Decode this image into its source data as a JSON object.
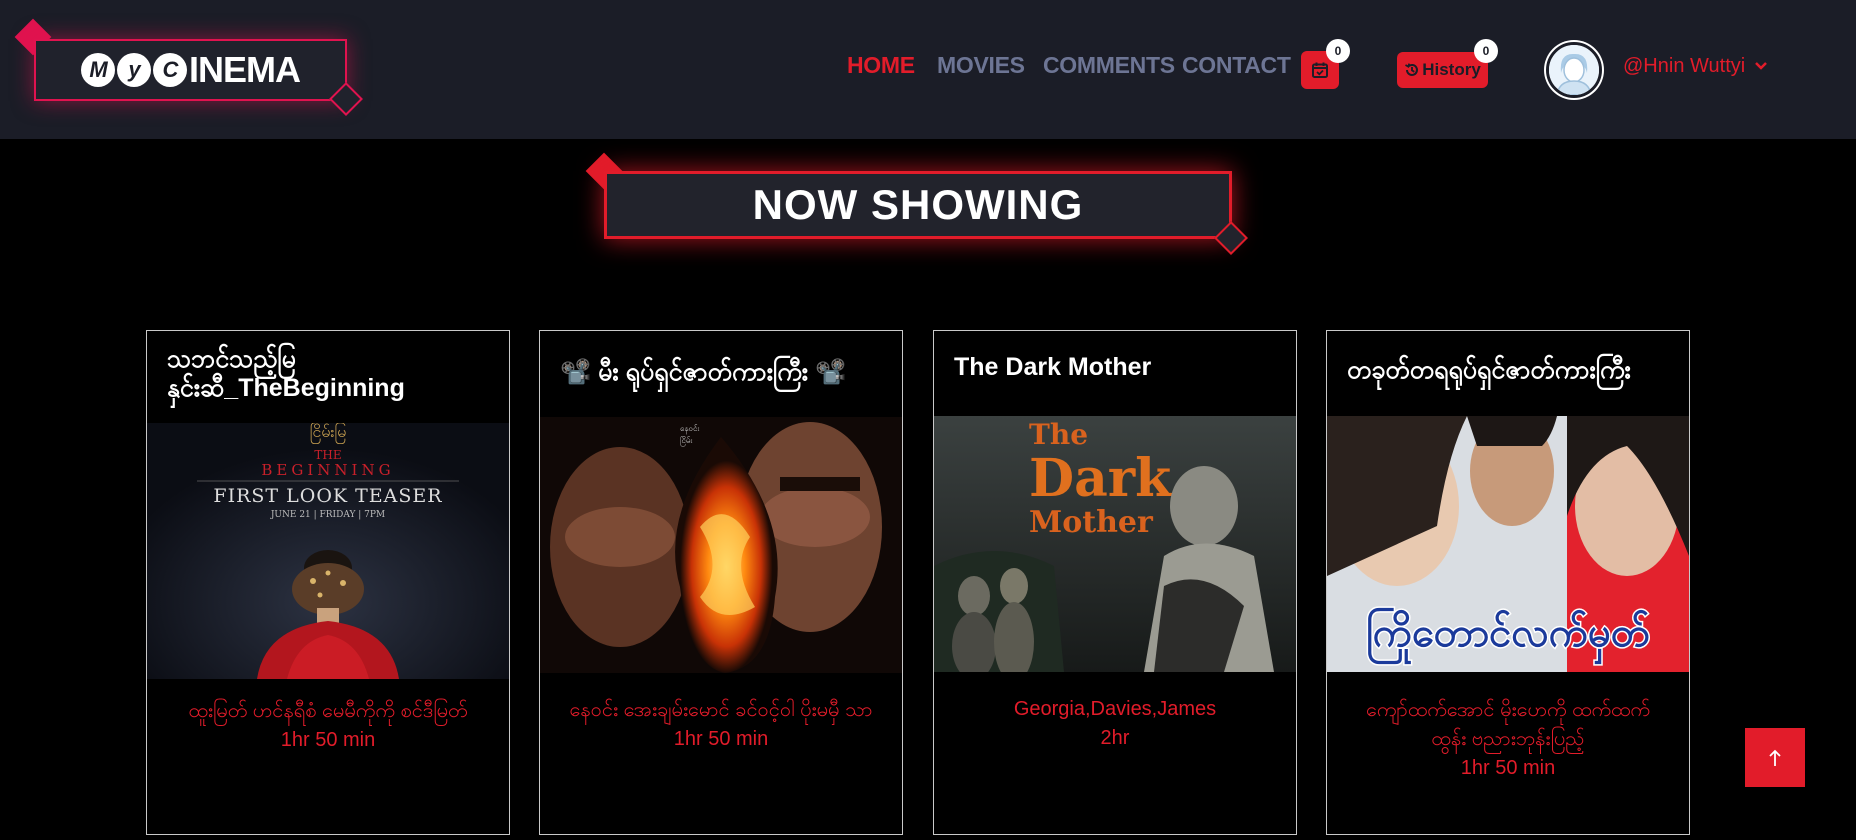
{
  "brand": {
    "logo_text": "MyCINEMA",
    "logo_letters": [
      "M",
      "y",
      "C"
    ],
    "logo_suffix": "INEMA"
  },
  "nav": {
    "items": [
      {
        "label": "HOME",
        "active": true
      },
      {
        "label": "MOVIES",
        "active": false
      },
      {
        "label": "COMMENTS",
        "active": false
      },
      {
        "label": "CONTACT",
        "active": false
      }
    ]
  },
  "header": {
    "cart_count": "0",
    "history_label": "History",
    "history_count": "0",
    "username": "@Hnin Wuttyi"
  },
  "section": {
    "title": "NOW SHOWING"
  },
  "movies": [
    {
      "title": "သဘင်သည့်မြ နှင်းဆီ_TheBeginning",
      "cast": "ထူးမြတ် ဟင်နရီစံ မေမီကိုကို စင်ဒီမြတ်",
      "duration": "1hr 50 min",
      "poster_lines": [
        "THE",
        "BEGINNING",
        "FIRST LOOK TEASER",
        "JUNE 21 | FRIDAY | 7PM"
      ]
    },
    {
      "title": "📽️ မီး ရုပ်ရှင်ဇာတ်ကားကြီး 📽️",
      "cast": "နေဝင်း အေးချမ်းမောင် ခင်ဝင့်ဝါ ပိုးမမှီ သာ",
      "duration": "1hr 50 min",
      "poster_lines": []
    },
    {
      "title": "The Dark Mother",
      "cast": "Georgia,Davies,James",
      "duration": "2hr",
      "poster_lines": [
        "The",
        "Dark",
        "Mother"
      ]
    },
    {
      "title": "တခုတ်တရရုပ်ရှင်ဇာတ်ကားကြီး",
      "cast": "ကျော်ထက်အောင် မိုးဟေကို ထက်ထက် ထွန်း ဗညားဘုန်းပြည့်",
      "duration": "1hr 50 min",
      "poster_lines": [
        "ကြိုတောင်လက်မှတ်"
      ]
    }
  ],
  "colors": {
    "accent": "#e21c2a",
    "logo_accent": "#e0134f",
    "header_bg": "#1b1d27",
    "nav_inactive": "#6d7594"
  },
  "icons": {
    "cart": "calendar-check-icon",
    "history": "history-icon",
    "chevron": "chevron-down-icon",
    "back_to_top": "arrow-up-icon"
  }
}
